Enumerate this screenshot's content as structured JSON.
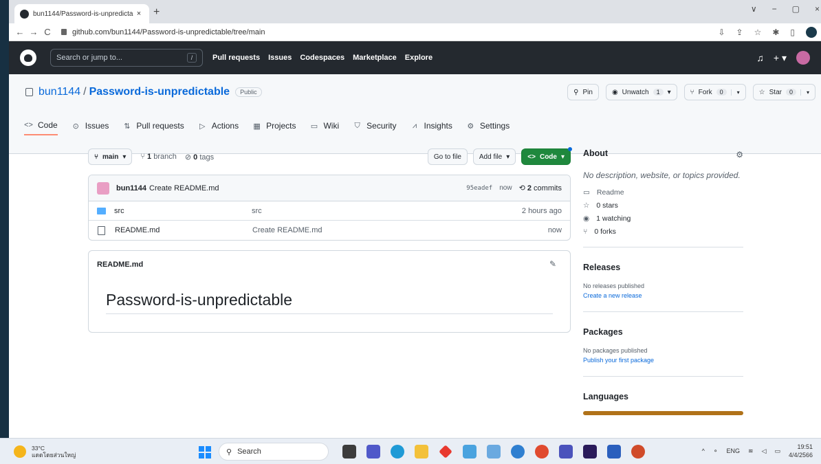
{
  "browser": {
    "tab_title": "bun1144/Password-is-unpredicta",
    "tab_close": "×",
    "new_tab": "+",
    "url": "github.com/bun1144/Password-is-unpredictable/tree/main",
    "window_controls": [
      "∨",
      "−",
      "▢",
      "×"
    ]
  },
  "gh_header": {
    "search_placeholder": "Search or jump to...",
    "search_shortcut": "/",
    "nav": [
      "Pull requests",
      "Issues",
      "Codespaces",
      "Marketplace",
      "Explore"
    ]
  },
  "repo": {
    "owner": "bun1144",
    "separator": "/",
    "name": "Password-is-unpredictable",
    "visibility": "Public",
    "pin_label": "Pin",
    "unwatch_label": "Unwatch",
    "watch_count": "1",
    "fork_label": "Fork",
    "fork_count": "0",
    "star_label": "Star",
    "star_count": "0",
    "tabs": [
      {
        "icon": "<>",
        "label": "Code"
      },
      {
        "icon": "⊙",
        "label": "Issues"
      },
      {
        "icon": "⇅",
        "label": "Pull requests"
      },
      {
        "icon": "▷",
        "label": "Actions"
      },
      {
        "icon": "▦",
        "label": "Projects"
      },
      {
        "icon": "▭",
        "label": "Wiki"
      },
      {
        "icon": "⛉",
        "label": "Security"
      },
      {
        "icon": "⩘",
        "label": "Insights"
      },
      {
        "icon": "⚙",
        "label": "Settings"
      }
    ]
  },
  "toolbar": {
    "branch": "main",
    "branch_count": "1",
    "branch_word": "branch",
    "tag_count": "0",
    "tag_word": "tags",
    "go_to_file": "Go to file",
    "add_file": "Add file",
    "code": "Code"
  },
  "commit": {
    "author": "bun1144",
    "message": "Create README.md",
    "sha": "95eadef",
    "age": "now",
    "commits_count": "2",
    "commits_word": "commits"
  },
  "files": [
    {
      "type": "folder",
      "name": "src",
      "message": "src",
      "age": "2 hours ago"
    },
    {
      "type": "file",
      "name": "README.md",
      "message": "Create README.md",
      "age": "now"
    }
  ],
  "readme": {
    "filename": "README.md",
    "heading": "Password-is-unpredictable"
  },
  "sidebar": {
    "about_title": "About",
    "description": "No description, website, or topics provided.",
    "readme": "Readme",
    "stars": "0 stars",
    "watching": "1 watching",
    "forks": "0 forks",
    "releases_title": "Releases",
    "releases_none": "No releases published",
    "releases_link": "Create a new release",
    "packages_title": "Packages",
    "packages_none": "No packages published",
    "packages_link": "Publish your first package",
    "languages_title": "Languages",
    "language_color": "#b07219"
  },
  "taskbar": {
    "temp": "33°C",
    "weather_text": "แดดโดยส่วนใหญ่",
    "search": "Search",
    "lang": "ENG",
    "time": "19:51",
    "date": "4/4/2566"
  }
}
